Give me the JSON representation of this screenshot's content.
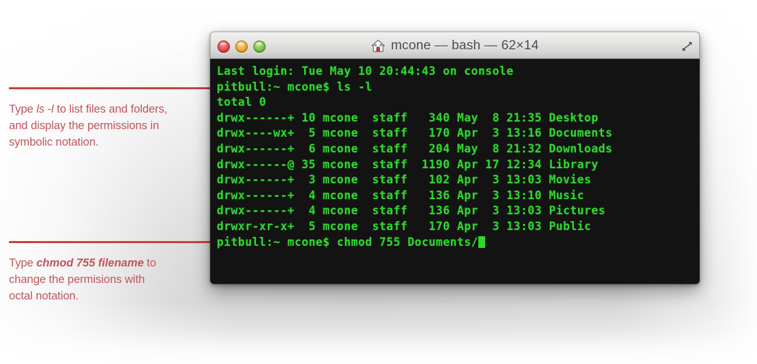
{
  "annotations": [
    {
      "id": "annotation-ls",
      "rule_color": "#c8403f",
      "text_color": "#c0555a",
      "parts": [
        {
          "text": "Type ",
          "style": "normal"
        },
        {
          "text": "ls -l",
          "style": "italic"
        },
        {
          "text": " to list files and folders, and display the permissions in symbolic notation.",
          "style": "normal"
        }
      ]
    },
    {
      "id": "annotation-chmod",
      "rule_color": "#c8403f",
      "text_color": "#c0555a",
      "parts": [
        {
          "text": "Type ",
          "style": "normal"
        },
        {
          "text": "chmod 755 filename",
          "style": "bold-italic"
        },
        {
          "text": " to change the permisions with octal notation.",
          "style": "normal"
        }
      ]
    }
  ],
  "window": {
    "title": "mcone — bash — 62×14",
    "home_icon": "home-icon",
    "fullscreen_icon": "fullscreen-arrows-icon",
    "traffic_lights": [
      {
        "name": "close-button",
        "color": "#e0524e"
      },
      {
        "name": "minimize-button",
        "color": "#f0ab38"
      },
      {
        "name": "zoom-button",
        "color": "#7ec44b"
      }
    ]
  },
  "terminal": {
    "background": "#131313",
    "text_color": "#2ed82e",
    "cols": 62,
    "rows": 14,
    "lines": [
      "Last login: Tue May 10 20:44:43 on console",
      "pitbull:~ mcone$ ls -l",
      "total 0",
      "drwx------+ 10 mcone  staff   340 May  8 21:35 Desktop",
      "drwx----wx+  5 mcone  staff   170 Apr  3 13:16 Documents",
      "drwx------+  6 mcone  staff   204 May  8 21:32 Downloads",
      "drwx------@ 35 mcone  staff  1190 Apr 17 12:34 Library",
      "drwx------+  3 mcone  staff   102 Apr  3 13:03 Movies",
      "drwx------+  4 mcone  staff   136 Apr  3 13:10 Music",
      "drwx------+  4 mcone  staff   136 Apr  3 13:03 Pictures",
      "drwxr-xr-x+  5 mcone  staff   170 Apr  3 13:03 Public"
    ],
    "prompt_line": "pitbull:~ mcone$ chmod 755 Documents/",
    "cursor": "block-cursor",
    "listing": [
      {
        "permissions": "drwx------+",
        "links": "10",
        "owner": "mcone",
        "group": "staff",
        "size": "340",
        "month": "May",
        "day": "8",
        "time": "21:35",
        "name": "Desktop"
      },
      {
        "permissions": "drwx----wx+",
        "links": "5",
        "owner": "mcone",
        "group": "staff",
        "size": "170",
        "month": "Apr",
        "day": "3",
        "time": "13:16",
        "name": "Documents"
      },
      {
        "permissions": "drwx------+",
        "links": "6",
        "owner": "mcone",
        "group": "staff",
        "size": "204",
        "month": "May",
        "day": "8",
        "time": "21:32",
        "name": "Downloads"
      },
      {
        "permissions": "drwx------@",
        "links": "35",
        "owner": "mcone",
        "group": "staff",
        "size": "1190",
        "month": "Apr",
        "day": "17",
        "time": "12:34",
        "name": "Library"
      },
      {
        "permissions": "drwx------+",
        "links": "3",
        "owner": "mcone",
        "group": "staff",
        "size": "102",
        "month": "Apr",
        "day": "3",
        "time": "13:03",
        "name": "Movies"
      },
      {
        "permissions": "drwx------+",
        "links": "4",
        "owner": "mcone",
        "group": "staff",
        "size": "136",
        "month": "Apr",
        "day": "3",
        "time": "13:10",
        "name": "Music"
      },
      {
        "permissions": "drwx------+",
        "links": "4",
        "owner": "mcone",
        "group": "staff",
        "size": "136",
        "month": "Apr",
        "day": "3",
        "time": "13:03",
        "name": "Pictures"
      },
      {
        "permissions": "drwxr-xr-x+",
        "links": "5",
        "owner": "mcone",
        "group": "staff",
        "size": "170",
        "month": "Apr",
        "day": "3",
        "time": "13:03",
        "name": "Public"
      }
    ]
  }
}
